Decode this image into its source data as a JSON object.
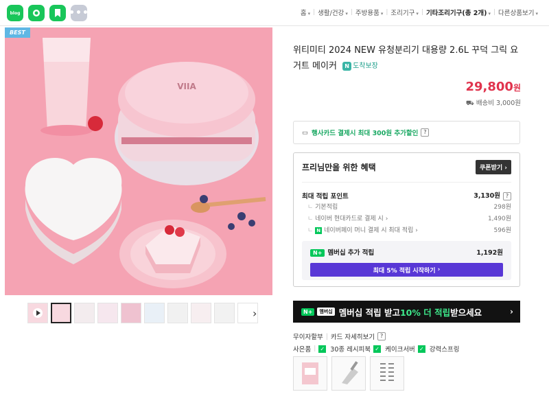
{
  "sns": [
    {
      "label": "blog",
      "icon": "blog-icon"
    },
    {
      "label": "",
      "icon": "talk-icon"
    },
    {
      "label": "",
      "icon": "bookmark-icon"
    },
    {
      "label": "•••",
      "icon": "more-icon"
    }
  ],
  "breadcrumb": [
    "홈",
    "생활/건강",
    "주방용품",
    "조리기구",
    "기타조리기구(총 2개)",
    "다른상품보기"
  ],
  "product": {
    "badge": "BEST",
    "title": "위티미티 2024 NEW 유청분리기 대용량 2.6L 꾸덕 그릭 요거트 메이커",
    "arrive_badge": "도착보장",
    "price": "29,800",
    "price_unit": "원",
    "shipping": "배송비 3,000원"
  },
  "card_promo": "행사카드 결제시 최대 300원 추가할인",
  "benefit": {
    "title": "프리님만을 위한 혜택",
    "coupon_btn": "쿠폰받기",
    "max_point_label": "최대 적립 포인트",
    "max_point_value": "3,130원",
    "rows": [
      {
        "label": "기본적립",
        "value": "298원"
      },
      {
        "label": "네이버 현대카드로 결제 시",
        "value": "1,490원"
      },
      {
        "label": "네이버페이 머니 결제 시 최대 적립",
        "value": "596원"
      }
    ],
    "member_label": "멤버십 추가 적립",
    "member_value": "1,192원",
    "member_btn": "최대 5% 적립 시작하기"
  },
  "banner": {
    "badge": "멤버십",
    "text_pre": "멤버십 적립 받고 ",
    "highlight": "10% 더 적립",
    "text_post": " 받으세요"
  },
  "links": [
    "무이자할부",
    "카드 자세히보기"
  ],
  "gifts": {
    "label": "사은품",
    "items": [
      "30종 레시피북",
      "케이크서버",
      "강력스프링"
    ]
  }
}
